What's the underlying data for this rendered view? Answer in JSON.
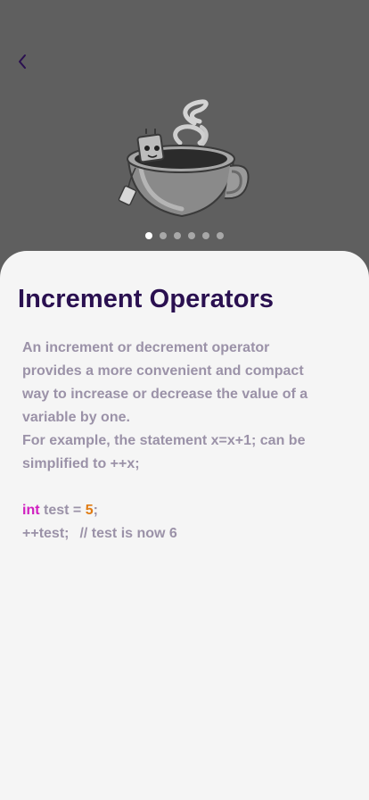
{
  "nav": {
    "back_icon": "chevron-left-icon"
  },
  "hero": {
    "image": "teacup-illustration"
  },
  "carousel": {
    "count": 6,
    "active_index": 0
  },
  "colors": {
    "header_bg": "#5f5f5f",
    "card_bg": "#f5f5f5",
    "title": "#2a1050",
    "body_text": "#9b92a8",
    "keyword": "#d01ec0",
    "number": "#e07b12"
  },
  "lesson": {
    "title": "Increment Operators",
    "para1": "An increment or decrement operator provides a more convenient and compact way to increase or decrease the value of a variable by one.",
    "para2": "For example, the statement x=x+1; can be simplified to ++x;",
    "code": {
      "line1_keyword": "int",
      "line1_mid": " test = ",
      "line1_number": "5",
      "line1_end": ";",
      "line2_code": "++test;",
      "line2_comment": "// test is now 6"
    }
  }
}
